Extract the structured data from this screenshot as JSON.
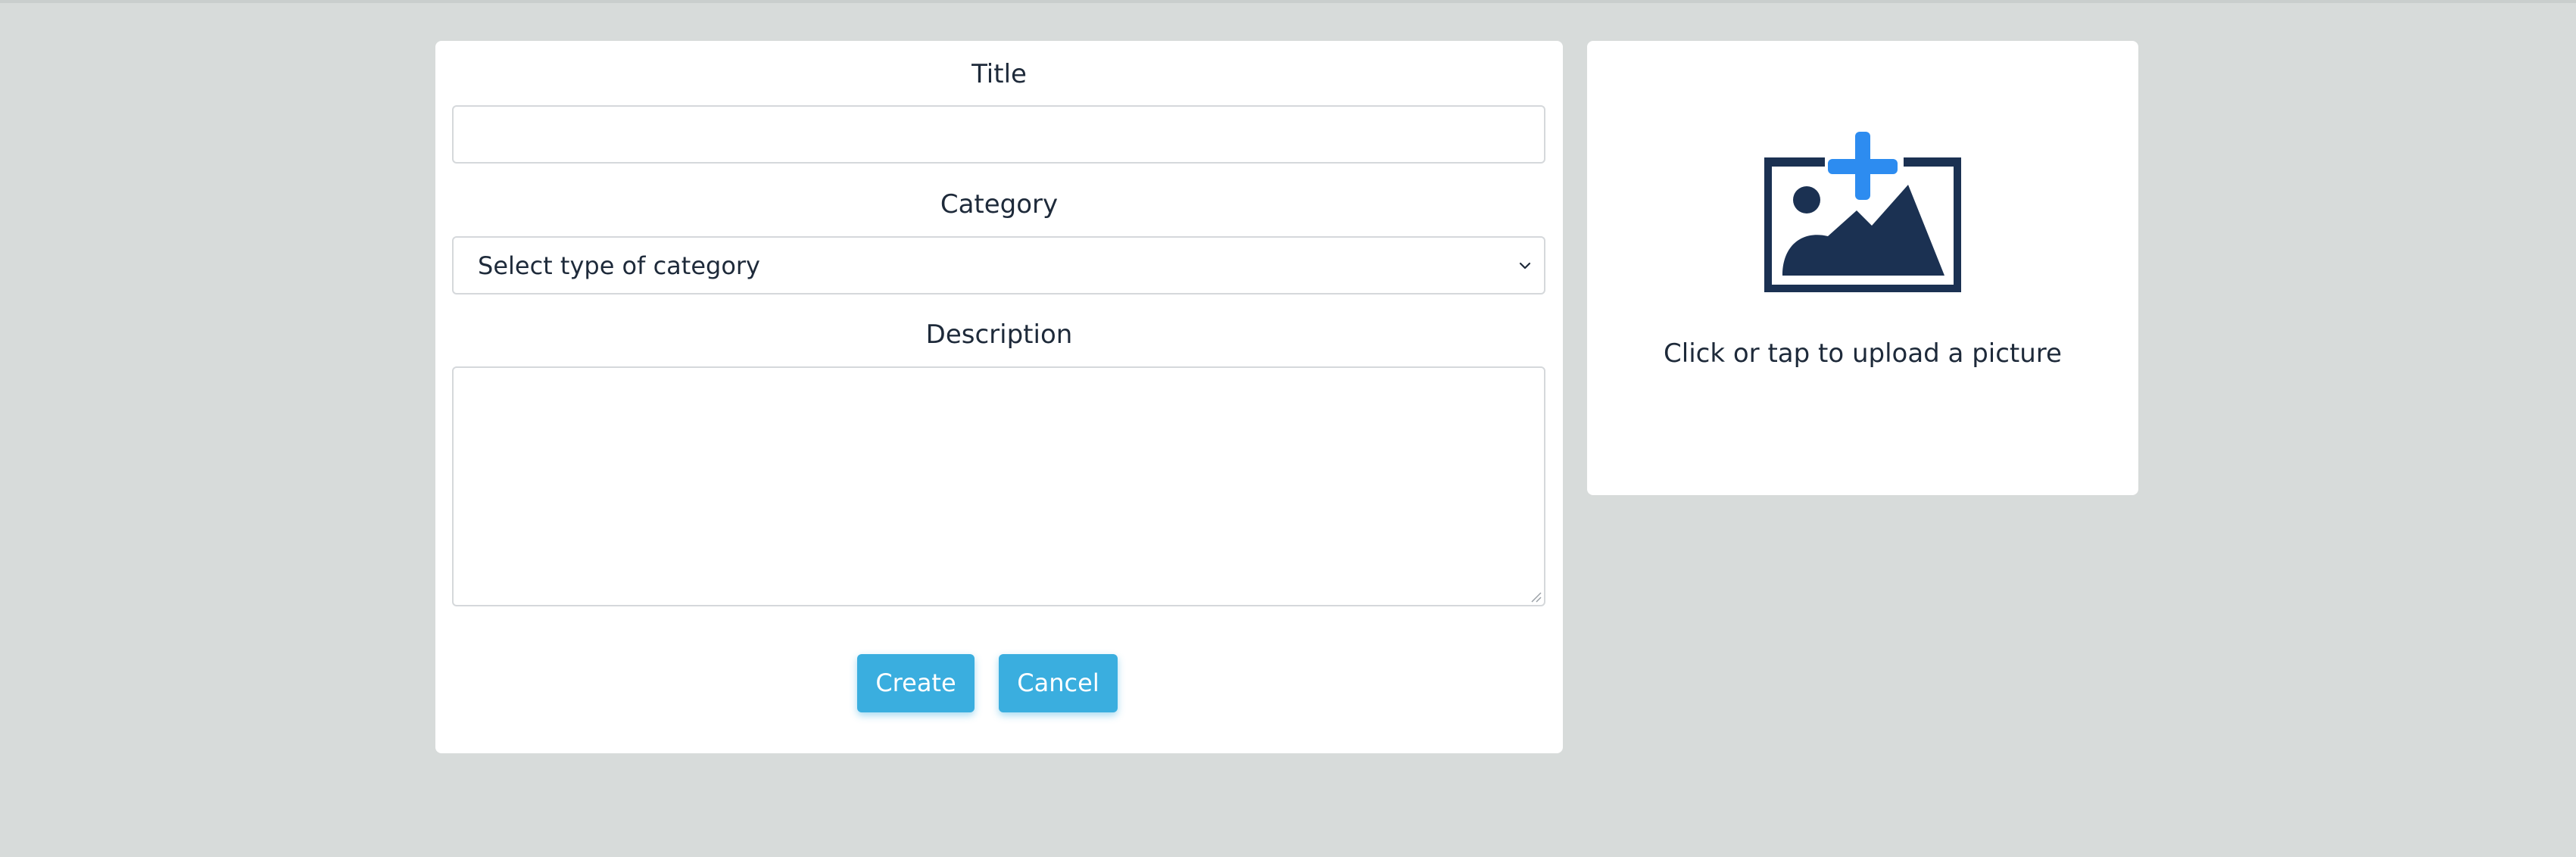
{
  "form": {
    "title_label": "Title",
    "title_value": "",
    "category_label": "Category",
    "category_selected": "Select type of category",
    "description_label": "Description",
    "description_value": "",
    "create_label": "Create",
    "cancel_label": "Cancel"
  },
  "upload": {
    "prompt": "Click or tap to upload a picture",
    "icon": "add-image-icon"
  },
  "colors": {
    "background": "#d7dbda",
    "card": "#ffffff",
    "button": "#3aaedf",
    "icon_dark": "#1b3152",
    "icon_accent": "#2d8cf0",
    "text": "#1e2a3a"
  }
}
